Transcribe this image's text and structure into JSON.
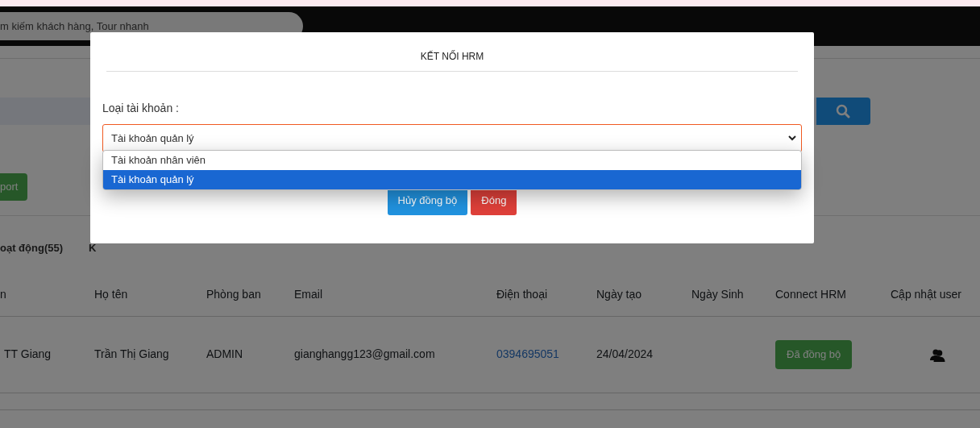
{
  "header": {
    "search": {
      "placeholder": "m kiếm khách hàng, Tour nhanh"
    }
  },
  "toolbar": {
    "export_button": "port"
  },
  "tabs": [
    {
      "label": "oạt động(55)"
    },
    {
      "label": "K"
    }
  ],
  "table": {
    "columns": [
      "n",
      "Họ tên",
      "Phòng ban",
      "Email",
      "Điện thoại",
      "Ngày tạo",
      "Ngày Sinh",
      "Connect HRM",
      "Cập nhật user"
    ],
    "rows": [
      {
        "cells": [
          {
            "kind": "text",
            "text": "TT Giang"
          },
          {
            "kind": "text",
            "text": "Trần Thị Giang"
          },
          {
            "kind": "text",
            "text": "ADMIN"
          },
          {
            "kind": "text",
            "text": "gianghangg123@gmail.com"
          },
          {
            "kind": "link",
            "text": "0394695051"
          },
          {
            "kind": "text",
            "text": "24/04/2024"
          },
          {
            "kind": "empty"
          },
          {
            "kind": "button",
            "text": "Đã đồng bộ"
          },
          {
            "kind": "icon"
          }
        ]
      }
    ]
  },
  "modal": {
    "title": "KẾT NỐI HRM",
    "field_label": "Loại tài khoản :",
    "select": {
      "value": "Tài khoản quản lý",
      "expanded": true,
      "options": [
        {
          "label": "Tài khoản nhân viên",
          "selected": false
        },
        {
          "label": "Tài khoản quản lý",
          "selected": true
        }
      ]
    },
    "buttons": [
      {
        "label": "Hủy đồng bộ",
        "kind": "primary"
      },
      {
        "label": "Đóng",
        "kind": "danger"
      }
    ]
  }
}
